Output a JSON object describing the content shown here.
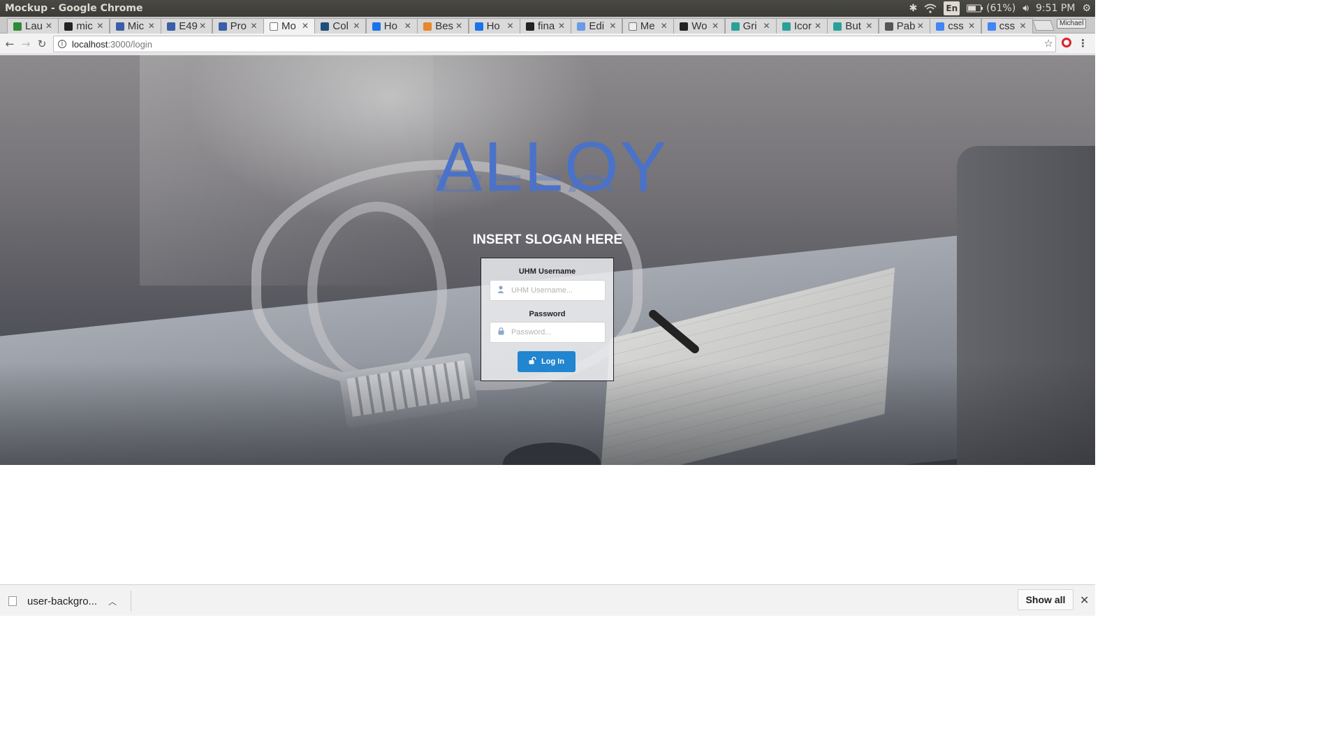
{
  "window": {
    "title": "Mockup - Google Chrome"
  },
  "tray": {
    "language": "En",
    "battery": "(61%)",
    "time": "9:51 PM"
  },
  "tabs": [
    {
      "label": "Lau",
      "favicon_color": "#2e8b3a"
    },
    {
      "label": "mic",
      "favicon_color": "#222222"
    },
    {
      "label": "Mic",
      "favicon_color": "#3b5ea8"
    },
    {
      "label": "E49",
      "favicon_color": "#3b5ea8"
    },
    {
      "label": "Pro",
      "favicon_color": "#3b5ea8"
    },
    {
      "label": "Mo",
      "favicon_color": "#ffffff"
    },
    {
      "label": "Col",
      "favicon_color": "#1f4e79"
    },
    {
      "label": "Ho",
      "favicon_color": "#1a73e8"
    },
    {
      "label": "Bes",
      "favicon_color": "#e8872c"
    },
    {
      "label": "Ho",
      "favicon_color": "#1a73e8"
    },
    {
      "label": "fina",
      "favicon_color": "#222222"
    },
    {
      "label": "Edi",
      "favicon_color": "#6a9be6"
    },
    {
      "label": "Me",
      "favicon_color": "#eeeeee"
    },
    {
      "label": "Wo",
      "favicon_color": "#222222"
    },
    {
      "label": "Gri",
      "favicon_color": "#2aa198"
    },
    {
      "label": "Icor",
      "favicon_color": "#2aa198"
    },
    {
      "label": "But",
      "favicon_color": "#2aa198"
    },
    {
      "label": "Pab",
      "favicon_color": "#555555"
    },
    {
      "label": "css",
      "favicon_color": "#4285f4"
    },
    {
      "label": "css",
      "favicon_color": "#4285f4"
    }
  ],
  "active_tab_index": 5,
  "profile_name": "Michael",
  "address_bar": {
    "host": "localhost",
    "path": ":3000/login"
  },
  "page": {
    "logo": "ALLOY",
    "slogan": "INSERT SLOGAN HERE",
    "username_label": "UHM Username",
    "username_placeholder": "UHM Username...",
    "password_label": "Password",
    "password_placeholder": "Password...",
    "login_button": "Log In"
  },
  "downloads": {
    "file_name": "user-backgro...",
    "show_all": "Show all"
  },
  "colors": {
    "logo": "#4a72c8",
    "button": "#2185d0"
  }
}
